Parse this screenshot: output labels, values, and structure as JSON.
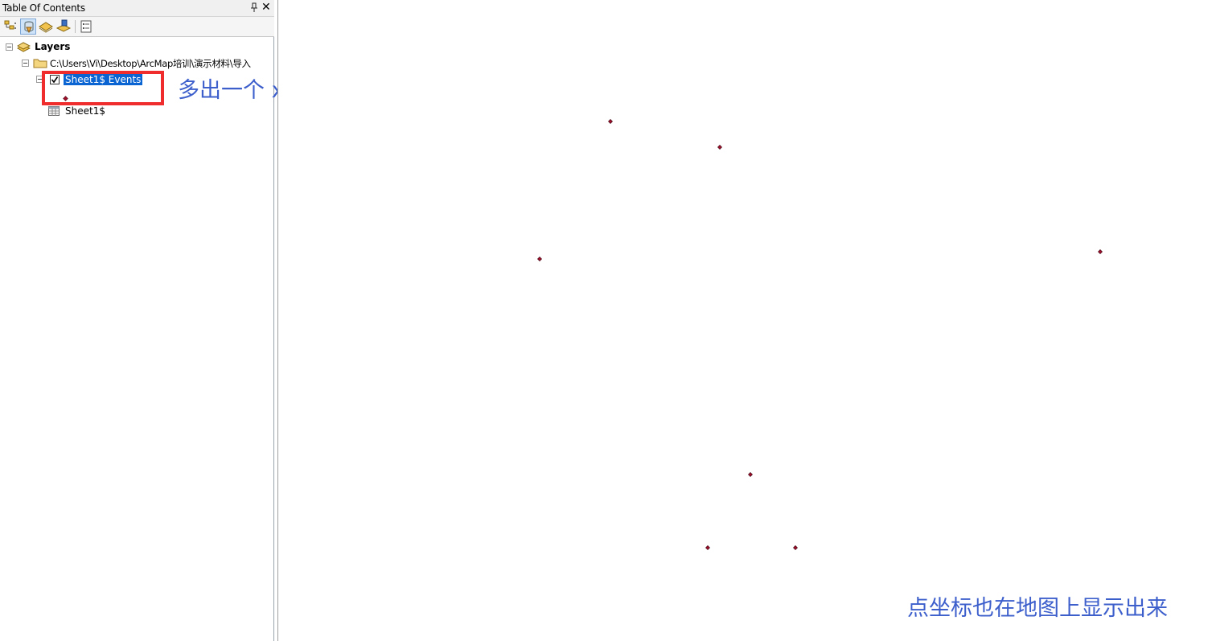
{
  "toc": {
    "title": "Table Of Contents",
    "toolbar_icons": [
      "list-by-drawing-order-icon",
      "list-by-source-icon",
      "list-by-visibility-icon",
      "list-by-selection-icon",
      "options-icon"
    ],
    "layers_label": "Layers",
    "folder_path": "C:\\Users\\Vi\\Desktop\\ArcMap培训\\演示材料\\导入",
    "event_layer_label": "Sheet1$ Events",
    "event_layer_checked": true,
    "table_label": "Sheet1$"
  },
  "annotations": {
    "callout_top": "多出一个 xxx Events",
    "callout_bottom": "点坐标也在地图上显示出来"
  },
  "colors": {
    "selection": "#0a64d2",
    "annotation_box": "#f02d2d",
    "annotation_text": "#3d5fcc",
    "point_fill": "#a0102a"
  },
  "map": {
    "point_count": 8
  }
}
